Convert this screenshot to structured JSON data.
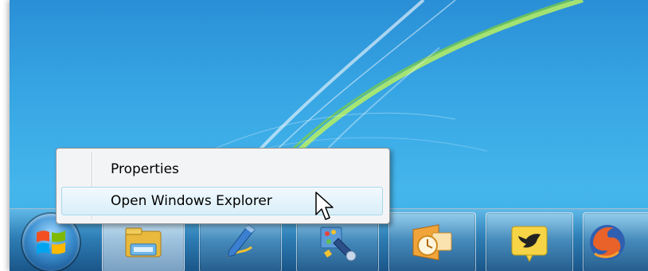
{
  "context_menu": {
    "items": [
      {
        "label": "Properties"
      },
      {
        "label": "Open Windows Explorer",
        "hovered": true
      }
    ]
  },
  "taskbar": {
    "buttons": [
      {
        "icon": "windows-explorer-icon",
        "active": true
      },
      {
        "icon": "windows-journal-icon",
        "active": false
      },
      {
        "icon": "paint-tools-icon",
        "active": false
      },
      {
        "icon": "outlook-icon",
        "active": false
      },
      {
        "icon": "tweetdeck-bird-icon",
        "active": false
      },
      {
        "icon": "firefox-icon",
        "active": false
      }
    ]
  },
  "colors": {
    "desktop": "#37a6e4",
    "menu_background": "#f3f4f6",
    "menu_hover": "#d9eef9",
    "accent_green": "#8fd14f"
  }
}
